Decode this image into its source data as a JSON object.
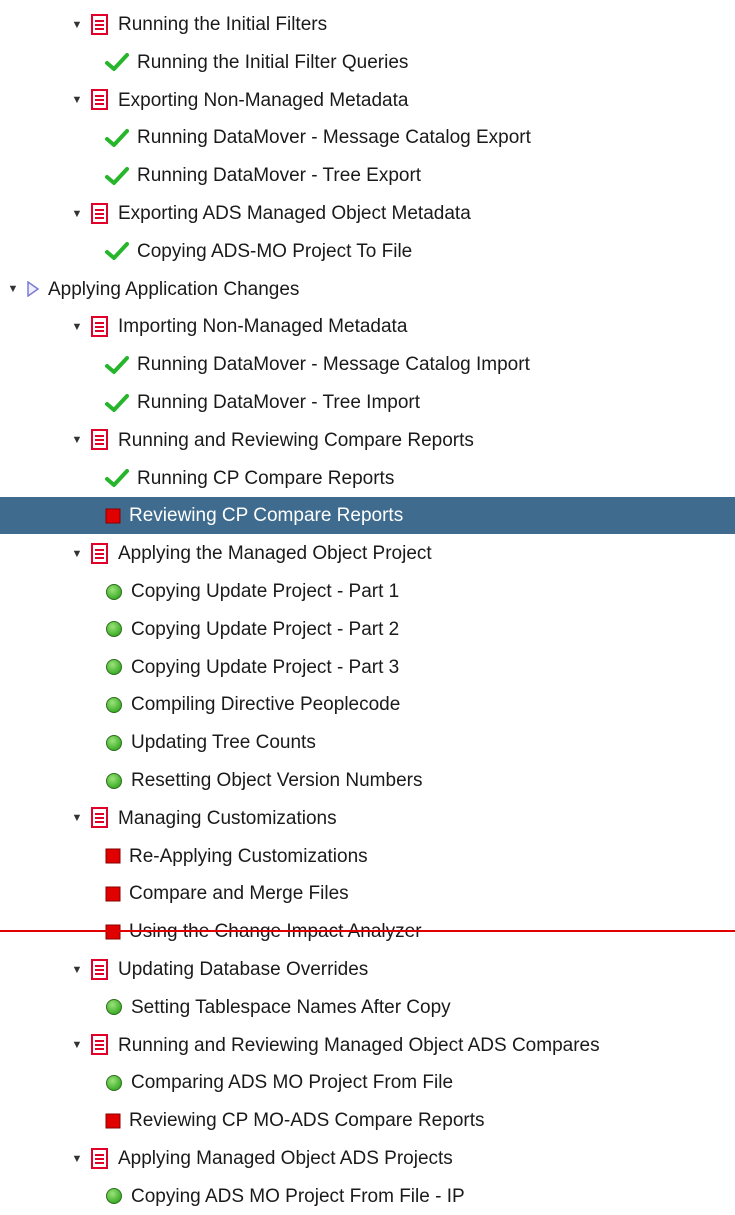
{
  "colors": {
    "selection_bg": "#3e6b8e",
    "check_green": "#27b52b",
    "status_red": "#e00000",
    "status_green": "#3fae2a",
    "doc_icon_red": "#e0002a",
    "phase_arrow": "#7b7bd6",
    "divider_red": "#e00000"
  },
  "tree": [
    {
      "level": 1,
      "type": "chapter",
      "icon": "document-icon",
      "expanded": true,
      "label": "Running the Initial Filters"
    },
    {
      "level": 2,
      "type": "step",
      "icon": "check-icon",
      "label": "Running the Initial Filter Queries"
    },
    {
      "level": 1,
      "type": "chapter",
      "icon": "document-icon",
      "expanded": true,
      "label": "Exporting Non-Managed Metadata"
    },
    {
      "level": 2,
      "type": "step",
      "icon": "check-icon",
      "label": "Running DataMover - Message Catalog Export"
    },
    {
      "level": 2,
      "type": "step",
      "icon": "check-icon",
      "label": "Running DataMover - Tree Export"
    },
    {
      "level": 1,
      "type": "chapter",
      "icon": "document-icon",
      "expanded": true,
      "label": "Exporting ADS Managed Object Metadata"
    },
    {
      "level": 2,
      "type": "step",
      "icon": "check-icon",
      "label": "Copying ADS-MO Project To File"
    },
    {
      "level": 0,
      "type": "phase",
      "icon": "play-triangle-icon",
      "expanded": true,
      "label": "Applying Application Changes"
    },
    {
      "level": 1,
      "type": "chapter",
      "icon": "document-icon",
      "expanded": true,
      "label": "Importing Non-Managed Metadata"
    },
    {
      "level": 2,
      "type": "step",
      "icon": "check-icon",
      "label": "Running DataMover - Message Catalog Import"
    },
    {
      "level": 2,
      "type": "step",
      "icon": "check-icon",
      "label": "Running DataMover - Tree Import"
    },
    {
      "level": 1,
      "type": "chapter",
      "icon": "document-icon",
      "expanded": true,
      "label": "Running and Reviewing Compare Reports"
    },
    {
      "level": 2,
      "type": "step",
      "icon": "check-icon",
      "label": "Running CP Compare Reports"
    },
    {
      "level": 2,
      "type": "step",
      "icon": "red-square-icon",
      "label": "Reviewing CP Compare Reports",
      "selected": true
    },
    {
      "level": 1,
      "type": "chapter",
      "icon": "document-icon",
      "expanded": true,
      "label": "Applying the Managed Object Project"
    },
    {
      "level": 2,
      "type": "step",
      "icon": "green-dot-icon",
      "label": "Copying Update Project - Part 1"
    },
    {
      "level": 2,
      "type": "step",
      "icon": "green-dot-icon",
      "label": "Copying Update Project - Part 2"
    },
    {
      "level": 2,
      "type": "step",
      "icon": "green-dot-icon",
      "label": "Copying Update Project - Part 3"
    },
    {
      "level": 2,
      "type": "step",
      "icon": "green-dot-icon",
      "label": "Compiling Directive Peoplecode"
    },
    {
      "level": 2,
      "type": "step",
      "icon": "green-dot-icon",
      "label": "Updating Tree Counts"
    },
    {
      "level": 2,
      "type": "step",
      "icon": "green-dot-icon",
      "label": "Resetting Object Version Numbers"
    },
    {
      "level": 1,
      "type": "chapter",
      "icon": "document-icon",
      "expanded": true,
      "label": "Managing Customizations"
    },
    {
      "level": 2,
      "type": "step",
      "icon": "red-square-icon",
      "label": "Re-Applying Customizations"
    },
    {
      "level": 2,
      "type": "step",
      "icon": "red-square-icon",
      "label": "Compare and Merge Files"
    },
    {
      "level": 2,
      "type": "step",
      "icon": "red-square-icon",
      "label": "Using the Change Impact Analyzer"
    },
    {
      "level": 1,
      "type": "chapter",
      "icon": "document-icon",
      "expanded": true,
      "label": "Updating Database Overrides"
    },
    {
      "level": 2,
      "type": "step",
      "icon": "green-dot-icon",
      "label": "Setting Tablespace Names After Copy"
    },
    {
      "level": 1,
      "type": "chapter",
      "icon": "document-icon",
      "expanded": true,
      "label": "Running and Reviewing Managed Object ADS Compares"
    },
    {
      "level": 2,
      "type": "step",
      "icon": "green-dot-icon",
      "label": "Comparing ADS MO Project From File"
    },
    {
      "level": 2,
      "type": "step",
      "icon": "red-square-icon",
      "label": "Reviewing CP MO-ADS Compare Reports"
    },
    {
      "level": 1,
      "type": "chapter",
      "icon": "document-icon",
      "expanded": true,
      "label": "Applying Managed Object ADS Projects"
    },
    {
      "level": 2,
      "type": "step",
      "icon": "green-dot-icon",
      "label": "Copying ADS MO Project From File - IP"
    }
  ]
}
